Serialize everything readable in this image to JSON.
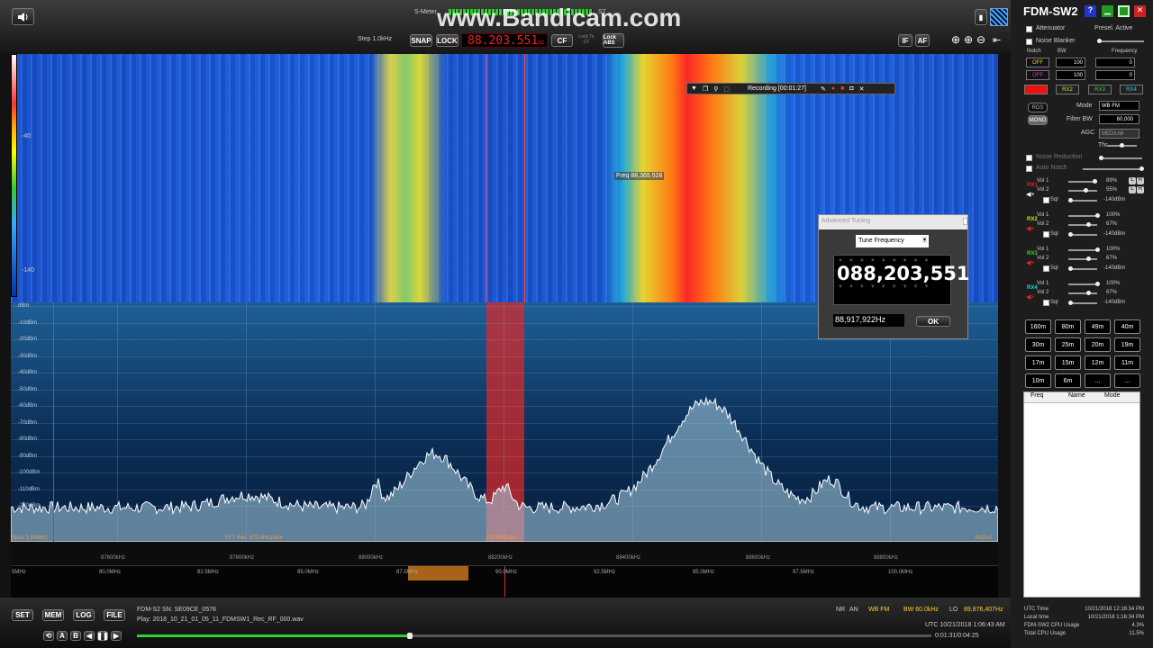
{
  "watermark": "www.Bandicam.com",
  "top": {
    "smeter_label": "S-Meter",
    "smeter_value": "S7",
    "step": "Step 1.0kHz",
    "snap": "SNAP",
    "lock": "LOCK",
    "frequency": "88.203.551",
    "freq_unit": "Hz",
    "cf": "CF",
    "lock_to_cf": "Lock To CF",
    "lock_abs": "Lock ABS",
    "if": "IF",
    "af": "AF"
  },
  "waterfall": {
    "level_high": "-40",
    "level_low": "-140",
    "freq_tooltip": "Freq 88,365,528"
  },
  "recording": {
    "text": "Recording [00:01:27]"
  },
  "spectrum": {
    "db_labels": [
      "dBm",
      "-10dBm",
      "-20dBm",
      "-30dBm",
      "-40dBm",
      "-50dBm",
      "-60dBm",
      "-70dBm",
      "-80dBm",
      "-90dBm",
      "-100dBm",
      "-110dBm",
      "-120dBm"
    ],
    "span": "Span 1.54MHz",
    "fft": "FFT Res. 375.0Hz/point",
    "div": "200.0kHz/div",
    "avg": "AVG=2"
  },
  "freq_axis": [
    "87600kHz",
    "87800kHz",
    "88000kHz",
    "88200kHz",
    "88400kHz",
    "88600kHz",
    "88800kHz"
  ],
  "band_axis": [
    "5MHz",
    "80.0MHz",
    "82.5MHz",
    "85.0MHz",
    "87.5MHz",
    "90.0MHz",
    "92.5MHz",
    "95.0MHz",
    "97.5MHz",
    "100.0MHz"
  ],
  "adv_tuning": {
    "title": "Advanced Tuning",
    "mode_select": "Tune Frequency",
    "display": "088,203,551",
    "input": "88,917,922Hz",
    "ok": "OK"
  },
  "bottom": {
    "set": "SET",
    "mem": "MEM",
    "log": "LOG",
    "file": "FILE",
    "device": "FDM-S2 SN: SE09CE_0578",
    "play": "Play: 2018_10_21_01_05_11_FDMSW1_Rec_RF_000.wav",
    "nr": "NR",
    "an": "AN",
    "mode": "WB FM",
    "bw": "BW 60.0kHz",
    "lo_label": "LO",
    "lo": "89,876,407Hz",
    "utc": "UTC 10/21/2018 1:06:43 AM",
    "time": "0:01:31/0:04:25"
  },
  "right": {
    "title": "FDM-SW2",
    "attenuator": "Attenuator",
    "presel": "Presel. Active",
    "noise_blanker": "Noise Blanker",
    "notch": "Notch",
    "bw": "BW",
    "frequency": "Frequency",
    "off1": "OFF",
    "off2": "OFF",
    "bw1": "100",
    "bw2": "100",
    "f1": "0",
    "f2": "0",
    "rx_tabs": [
      "RX1",
      "RX2",
      "RX3",
      "RX4"
    ],
    "rds": "RDS",
    "mono": "MONO",
    "mode_label": "Mode",
    "mode": "WB FM",
    "filter_label": "Filter BW",
    "filter": "60,000",
    "agc_label": "AGC",
    "agc": "MEDIUM",
    "thr": "Thr",
    "noise_reduction": "Noise Reduction",
    "auto_notch": "Auto Notch",
    "rx": [
      {
        "name": "RX1",
        "vol1": "Vol 1",
        "v1": "89%",
        "vol2": "Vol 2",
        "v2": "55%",
        "sql": "Sql",
        "dbm": "-140dBm"
      },
      {
        "name": "RX2",
        "vol1": "Vol 1",
        "v1": "100%",
        "vol2": "Vol 2",
        "v2": "67%",
        "sql": "Sql",
        "dbm": "-140dBm"
      },
      {
        "name": "RX3",
        "vol1": "Vol 1",
        "v1": "100%",
        "vol2": "Vol 2",
        "v2": "67%",
        "sql": "Sql",
        "dbm": "-140dBm"
      },
      {
        "name": "RX4",
        "vol1": "Vol 1",
        "v1": "100%",
        "vol2": "Vol 2",
        "v2": "67%",
        "sql": "Sql",
        "dbm": "-140dBm"
      }
    ],
    "bands": [
      "160m",
      "80m",
      "49m",
      "40m",
      "30m",
      "25m",
      "20m",
      "19m",
      "17m",
      "15m",
      "12m",
      "11m",
      "10m",
      "6m",
      "...",
      "..."
    ],
    "mem_cols": [
      "Freq",
      "Name",
      "Mode"
    ],
    "status": [
      {
        "label": "UTC Time",
        "value": "10/21/2018 12:16:34 PM"
      },
      {
        "label": "Local time",
        "value": "10/21/2018 1:16:34 PM"
      },
      {
        "label": "FDM-SW2 CPU Usage",
        "value": "4.3%"
      },
      {
        "label": "Total CPU Usage",
        "value": "11.5%"
      }
    ]
  }
}
